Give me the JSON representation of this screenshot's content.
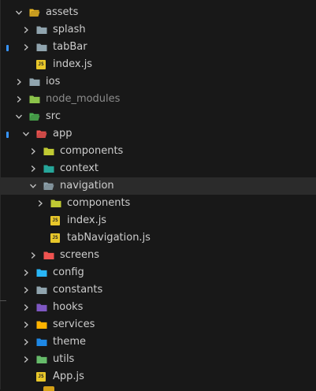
{
  "explorer": {
    "items": [
      {
        "label": "assets",
        "level": 1,
        "type": "folder",
        "expanded": true,
        "icon": "folder-assets-icon",
        "color": "#e6b422"
      },
      {
        "label": "splash",
        "level": 2,
        "type": "folder",
        "expanded": false,
        "icon": "folder-icon",
        "color": "#90a4ae"
      },
      {
        "label": "tabBar",
        "level": 2,
        "type": "folder",
        "expanded": false,
        "icon": "folder-icon",
        "color": "#90a4ae"
      },
      {
        "label": "index.js",
        "level": 2,
        "type": "file",
        "icon": "javascript-file-icon",
        "color": "#e8c72a"
      },
      {
        "label": "ios",
        "level": 1,
        "type": "folder",
        "expanded": false,
        "icon": "folder-ios-icon",
        "color": "#90a4ae"
      },
      {
        "label": "node_modules",
        "level": 1,
        "type": "folder",
        "expanded": false,
        "icon": "folder-node-icon",
        "color": "#8bc34a",
        "dim": true
      },
      {
        "label": "src",
        "level": 1,
        "type": "folder",
        "expanded": true,
        "icon": "folder-src-icon",
        "color": "#4caf50"
      },
      {
        "label": "app",
        "level": 2,
        "type": "folder",
        "expanded": true,
        "icon": "folder-app-icon",
        "color": "#ef5350"
      },
      {
        "label": "components",
        "level": 3,
        "type": "folder",
        "expanded": false,
        "icon": "folder-components-icon",
        "color": "#c0ca33"
      },
      {
        "label": "context",
        "level": 3,
        "type": "folder",
        "expanded": false,
        "icon": "folder-context-icon",
        "color": "#26a69a"
      },
      {
        "label": "navigation",
        "level": 3,
        "type": "folder",
        "expanded": true,
        "icon": "folder-navigation-icon",
        "color": "#90a4ae",
        "selected": true
      },
      {
        "label": "components",
        "level": 4,
        "type": "folder",
        "expanded": false,
        "icon": "folder-components-icon",
        "color": "#c0ca33"
      },
      {
        "label": "index.js",
        "level": 4,
        "type": "file",
        "icon": "javascript-file-icon",
        "color": "#e8c72a"
      },
      {
        "label": "tabNavigation.js",
        "level": 4,
        "type": "file",
        "icon": "javascript-file-icon",
        "color": "#e8c72a"
      },
      {
        "label": "screens",
        "level": 3,
        "type": "folder",
        "expanded": false,
        "icon": "folder-screens-icon",
        "color": "#ef5350"
      },
      {
        "label": "config",
        "level": 2,
        "type": "folder",
        "expanded": false,
        "icon": "folder-config-icon",
        "color": "#29b6f6"
      },
      {
        "label": "constants",
        "level": 2,
        "type": "folder",
        "expanded": false,
        "icon": "folder-constants-icon",
        "color": "#90a4ae"
      },
      {
        "label": "hooks",
        "level": 2,
        "type": "folder",
        "expanded": false,
        "icon": "folder-hooks-icon",
        "color": "#7e57c2"
      },
      {
        "label": "services",
        "level": 2,
        "type": "folder",
        "expanded": false,
        "icon": "folder-services-icon",
        "color": "#ffb300"
      },
      {
        "label": "theme",
        "level": 2,
        "type": "folder",
        "expanded": false,
        "icon": "folder-theme-icon",
        "color": "#1e88e5"
      },
      {
        "label": "utils",
        "level": 2,
        "type": "folder",
        "expanded": false,
        "icon": "folder-utils-icon",
        "color": "#66bb6a"
      },
      {
        "label": "App.js",
        "level": 2,
        "type": "file",
        "icon": "javascript-file-icon",
        "color": "#e8c72a"
      }
    ]
  },
  "colors": {
    "background": "#181818",
    "selected_row": "#2b2b2b",
    "git_modified_marker": "#3794ff",
    "text": "#cccccc",
    "dim_text": "#8c8c8c"
  }
}
